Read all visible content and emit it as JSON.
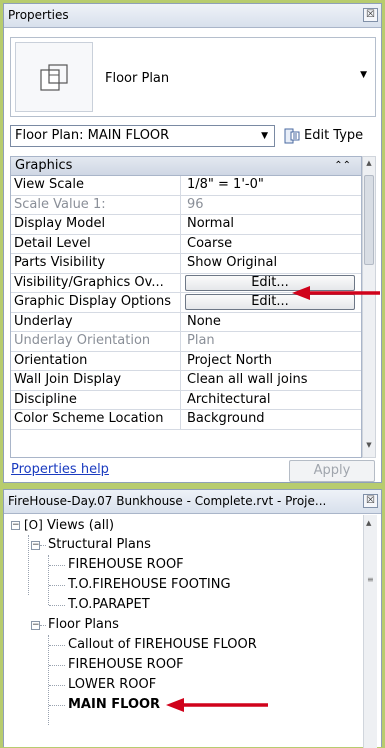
{
  "properties": {
    "title": "Properties",
    "close_label": "☒",
    "type_selector": {
      "type_name": "Floor Plan"
    },
    "instance_filter": {
      "value": "Floor Plan: MAIN FLOOR"
    },
    "edit_type_label": "Edit Type",
    "group": {
      "label": "Graphics"
    },
    "rows": [
      {
        "name": "View Scale",
        "value": "1/8\" = 1'-0\""
      },
      {
        "name": "Scale Value    1:",
        "value": "96"
      },
      {
        "name": "Display Model",
        "value": "Normal"
      },
      {
        "name": "Detail Level",
        "value": "Coarse"
      },
      {
        "name": "Parts Visibility",
        "value": "Show Original"
      },
      {
        "name": "Visibility/Graphics Ov...",
        "value": "Edit..."
      },
      {
        "name": "Graphic Display Options",
        "value": "Edit..."
      },
      {
        "name": "Underlay",
        "value": "None"
      },
      {
        "name": "Underlay Orientation",
        "value": "Plan"
      },
      {
        "name": "Orientation",
        "value": "Project North"
      },
      {
        "name": "Wall Join Display",
        "value": "Clean all wall joins"
      },
      {
        "name": "Discipline",
        "value": "Architectural"
      },
      {
        "name": "Color Scheme Location",
        "value": "Background"
      }
    ],
    "help_link": "Properties help",
    "apply_label": "Apply"
  },
  "browser": {
    "title": "FireHouse-Day.07 Bunkhouse - Complete.rvt - Proje...",
    "close_label": "☒",
    "root": {
      "label": "Views (all)"
    },
    "groups": [
      {
        "label": "Structural Plans",
        "items": [
          "FIREHOUSE ROOF",
          "T.O.FIREHOUSE FOOTING",
          "T.O.PARAPET"
        ]
      },
      {
        "label": "Floor Plans",
        "items": [
          "Callout of FIREHOUSE FLOOR",
          "FIREHOUSE ROOF",
          "LOWER ROOF",
          "MAIN FLOOR"
        ]
      }
    ],
    "selected_item": "MAIN FLOOR"
  },
  "colors": {
    "background": "#b7cc6e",
    "annotation_arrow": "#d0021b",
    "link": "#1a3bc0"
  }
}
